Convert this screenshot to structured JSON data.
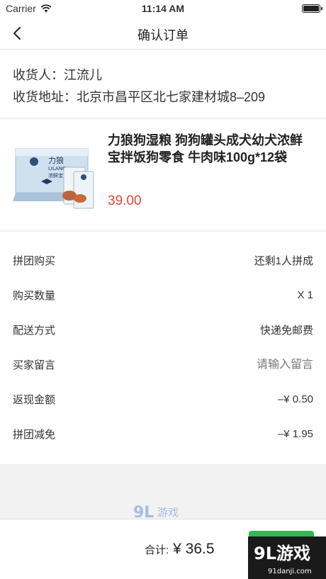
{
  "status_bar": {
    "carrier": "Carrier",
    "time": "11:14 AM"
  },
  "nav": {
    "title": "确认订单",
    "back_icon": "chevron-left-icon"
  },
  "address": {
    "receiver": "收货人：江流儿",
    "location": "收货地址：北京市昌平区北七家建材城8–209"
  },
  "product": {
    "name": "力狼狗湿粮 狗狗罐头成犬幼犬浓鲜宝拌饭狗零食 牛肉味100g*12袋",
    "price": "39.00",
    "image_brand": "力狼",
    "image_brand_en": "LILANG",
    "image_sub": "浓鲜宝"
  },
  "details": [
    {
      "label": "拼团购买",
      "value": "还剩1人拼成"
    },
    {
      "label": "购买数量",
      "value": "X 1"
    },
    {
      "label": "配送方式",
      "value": "快递免邮费"
    },
    {
      "label": "买家留言",
      "placeholder": "请输入留言"
    },
    {
      "label": "返现金额",
      "value": "–¥ 0.50"
    },
    {
      "label": "拼团减免",
      "value": "–¥ 1.95"
    }
  ],
  "bottom": {
    "total_label": "合计:",
    "total_amount": "¥ 36.5"
  },
  "watermark": {
    "logo": "9L游戏",
    "site": "91danji.com"
  },
  "colors": {
    "price": "#e8453c",
    "submit": "#2dbb52"
  }
}
